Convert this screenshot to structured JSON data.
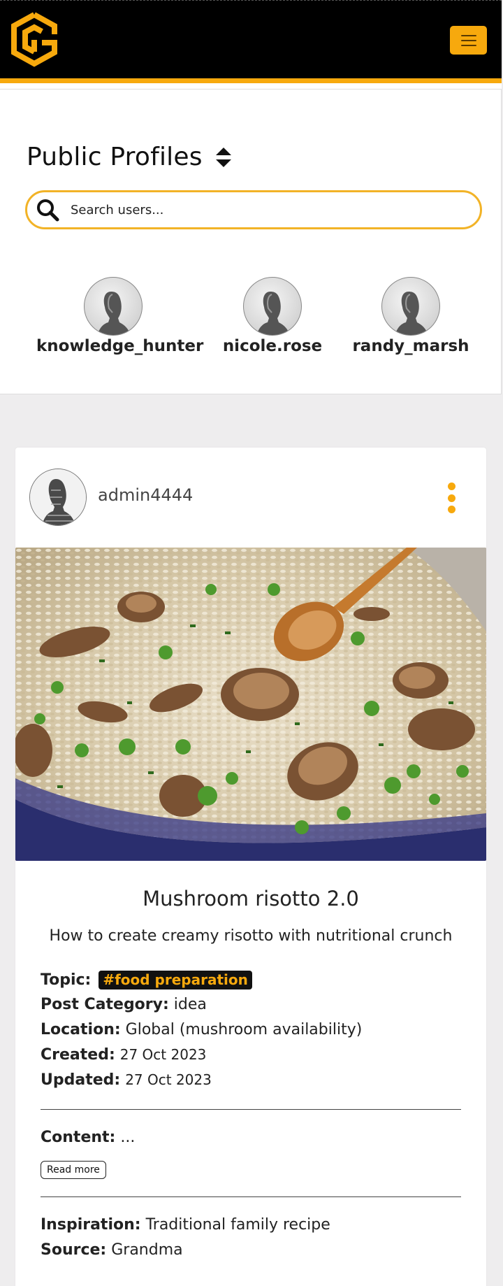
{
  "header": {
    "logo_icon": "cube-logo-icon",
    "menu_icon": "hamburger-menu-icon",
    "colors": {
      "accent": "#f7a90d",
      "bar": "#000000"
    }
  },
  "profiles": {
    "title": "Public Profiles",
    "sort_icon": "sort-updown-icon",
    "search": {
      "placeholder": "Search users...",
      "value": "",
      "icon": "search-icon"
    },
    "users": [
      {
        "username": "knowledge_hunter"
      },
      {
        "username": "nicole.rose"
      },
      {
        "username": "randy_marsh"
      }
    ]
  },
  "post": {
    "author": "admin4444",
    "options_icon": "vertical-dots-icon",
    "image_alt": "mushroom risotto in pot",
    "title": "Mushroom risotto 2.0",
    "subtitle": "How to create creamy risotto with nutritional crunch",
    "topic_label": "Topic:",
    "topic": "#food preparation",
    "category_label": "Post Category:",
    "category": "idea",
    "location_label": "Location:",
    "location": "Global (mushroom availability)",
    "created_label": "Created:",
    "created": "27 Oct 2023",
    "updated_label": "Updated:",
    "updated": "27 Oct 2023",
    "content_label": "Content:",
    "content": "...",
    "read_more": "Read more",
    "inspiration_label": "Inspiration:",
    "inspiration": "Traditional family recipe",
    "source_label": "Source:",
    "source": "Grandma"
  }
}
